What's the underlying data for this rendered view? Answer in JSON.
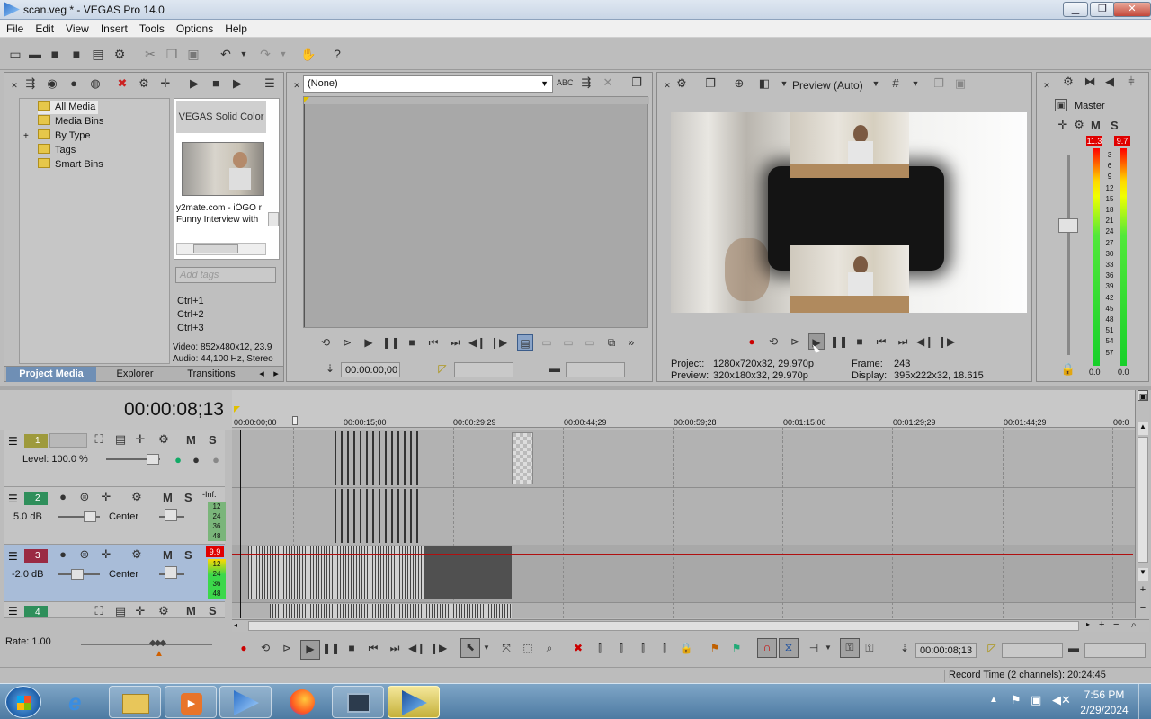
{
  "window": {
    "title": "scan.veg * - VEGAS Pro 14.0"
  },
  "menu": [
    "File",
    "Edit",
    "View",
    "Insert",
    "Tools",
    "Options",
    "Help"
  ],
  "project_media": {
    "tree": [
      "All Media",
      "Media Bins",
      "By Type",
      "Tags",
      "Smart Bins"
    ],
    "tree_expander": "+",
    "solid_color_label": "VEGAS Solid Color",
    "thumb_caption_1": "y2mate.com - iÖGO r",
    "thumb_caption_2": "Funny Interview with",
    "add_tags_placeholder": "Add tags",
    "shortcuts": [
      "Ctrl+1",
      "Ctrl+2",
      "Ctrl+3"
    ],
    "video_info": "Video: 852x480x12, 23.9",
    "audio_info": "Audio: 44,100 Hz, Stereo",
    "tabs": [
      "Project Media",
      "Explorer",
      "Transitions"
    ]
  },
  "trimmer": {
    "dropdown_value": "(None)",
    "timecode": "00:00:00;00"
  },
  "preview": {
    "quality": "Preview (Auto)",
    "project_label": "Project:",
    "project_value": "1280x720x32, 29.970p",
    "preview_label": "Preview:",
    "preview_value": "320x180x32, 29.970p",
    "frame_label": "Frame:",
    "frame_value": "243",
    "display_label": "Display:",
    "display_value": "395x222x32, 18.615"
  },
  "master": {
    "label": "Master",
    "peak_left": "11.3",
    "peak_right": "9.7",
    "scale": [
      "3",
      "6",
      "9",
      "12",
      "15",
      "18",
      "21",
      "24",
      "27",
      "30",
      "33",
      "36",
      "39",
      "42",
      "45",
      "48",
      "51",
      "54",
      "57"
    ],
    "bottom_left": "0.0",
    "bottom_right": "0.0"
  },
  "timeline": {
    "cursor_time": "00:00:08;13",
    "ruler": [
      "00:00:00;00",
      "00:00:15;00",
      "00:00:29;29",
      "00:00:44;29",
      "00:00:59;28",
      "00:01:15;00",
      "00:01:29;29",
      "00:01:44;29",
      "00:0"
    ],
    "tracks": [
      {
        "num": "1",
        "type": "video",
        "level": "Level: 100.0 %"
      },
      {
        "num": "2",
        "type": "audio",
        "volume": "5.0 dB",
        "pan": "Center",
        "peak": "-Inf.",
        "meter": [
          "12",
          "24",
          "36",
          "48"
        ]
      },
      {
        "num": "3",
        "type": "audio",
        "volume": "-2.0 dB",
        "pan": "Center",
        "peak": "9.9",
        "meter": [
          "12",
          "24",
          "36",
          "48"
        ]
      },
      {
        "num": "4",
        "type": "audio"
      }
    ],
    "mute_label": "M",
    "solo_label": "S",
    "rate": "Rate: 1.00",
    "bottom_timecode": "00:00:08;13",
    "record_time": "Record Time (2 channels): 20:24:45"
  },
  "taskbar": {
    "time": "7:56 PM",
    "date": "2/29/2024"
  },
  "colors": {
    "track1": "#9e9a3c",
    "track2": "#2f8f5b",
    "track3": "#9a2a43",
    "track4": "#2f8f5b",
    "selected_track": "#a8bcd8"
  }
}
